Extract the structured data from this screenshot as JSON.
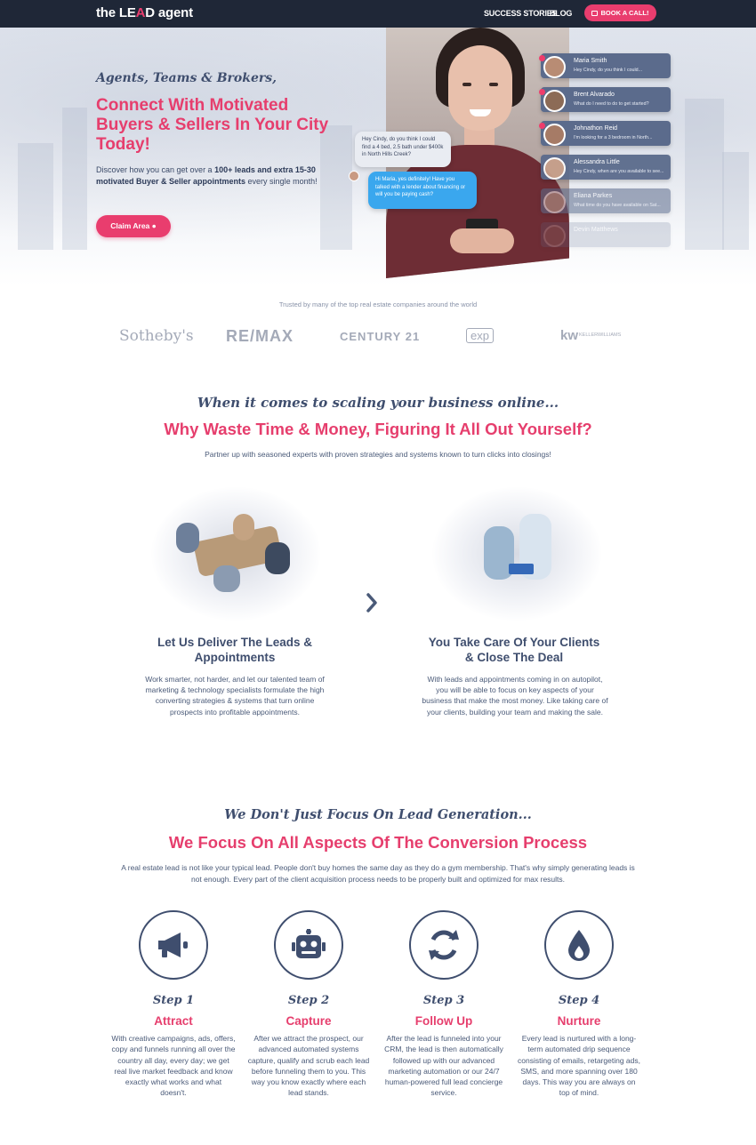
{
  "nav": {
    "logo_pre": "the LE",
    "logo_a": "A",
    "logo_post": "D agent",
    "link_success": "SUCCESS STORIES",
    "link_blog": "BLOG",
    "book_label": "BOOK A CALL!"
  },
  "hero": {
    "tagline": "Agents, Teams & Brokers,",
    "headline": "Connect With Motivated Buyers & Sellers In Your City Today!",
    "desc_1": "Discover how you can get over a ",
    "desc_bold_1": "100+ leads and extra 15-30 motivated Buyer & Seller appointments",
    "desc_2": " every single month!",
    "claim_label": "Claim Area",
    "bubble_gray": "Hey Cindy, do you think I could find a 4 bed, 2.5 bath under $400k in North Hills Creek?",
    "bubble_blue": "Hi Maria, yes definitely! Have you talked with a lender about financing or will you be paying cash?",
    "contacts": [
      {
        "name": "Maria Smith",
        "msg": "Hey Cindy, do you think I could..."
      },
      {
        "name": "Brent Alvarado",
        "msg": "What do I need to do to get started?"
      },
      {
        "name": "Johnathon Reid",
        "msg": "I'm looking for a 3 bedroom in North..."
      },
      {
        "name": "Alessandra Little",
        "msg": "Hey Cindy, when are you available to see..."
      },
      {
        "name": "Eliana Parkes",
        "msg": "What time do you have available on Sat..."
      },
      {
        "name": "Devin Matthews",
        "msg": ""
      }
    ]
  },
  "trusted": {
    "text": "Trusted by many of the top real estate companies around the world",
    "brands": [
      "Sotheby's",
      "RE/MAX",
      "CENTURY 21",
      "exp",
      "kw",
      "KELLERWILLIAMS"
    ]
  },
  "why": {
    "script": "When it comes to scaling your business online...",
    "title": "Why Waste Time & Money, Figuring It All Out Yourself?",
    "sub": "Partner up with seasoned experts with proven strategies and systems known to turn clicks into closings!",
    "col1_title": "Let Us Deliver The Leads & Appointments",
    "col1_text": "Work smarter, not harder, and let our talented team of marketing & technology specialists formulate the high converting strategies & systems that turn online prospects into profitable appointments.",
    "col2_title": "You Take Care Of Your Clients & Close The Deal",
    "col2_text": "With leads and appointments coming in on autopilot, you will be able to focus on key aspects of your business that make the most money. Like taking care of your clients, building your team and making the sale."
  },
  "process": {
    "script": "We Don't Just Focus On Lead Generation...",
    "title": "We Focus On All Aspects Of The Conversion Process",
    "sub": "A real estate lead is not like your typical lead. People don't buy homes the same day as they do a gym membership. That's why simply generating leads is not enough. Every part of the client acquisition process needs to be properly built and optimized for max results.",
    "steps": [
      {
        "label": "Step 1",
        "name": "Attract",
        "icon": "megaphone-icon",
        "text": "With creative campaigns, ads, offers, copy and funnels running all over the country all day, every day; we get real live market feedback and know exactly what works and what doesn't."
      },
      {
        "label": "Step 2",
        "name": "Capture",
        "icon": "robot-icon",
        "text": "After we attract the prospect, our advanced automated systems capture, qualify and scrub each lead before funneling them to you. This way you know exactly where each lead stands."
      },
      {
        "label": "Step 3",
        "name": "Follow Up",
        "icon": "sync-icon",
        "text": "After the lead is funneled into your CRM, the lead is then automatically followed up with our advanced marketing automation or our 24/7 human-powered full lead concierge service."
      },
      {
        "label": "Step 4",
        "name": "Nurture",
        "icon": "drop-icon",
        "text": "Every lead is nurtured with a long-term automated drip sequence consisting of emails, retargeting ads, SMS, and more spanning over 180 days. This way you are always on top of mind."
      }
    ]
  },
  "colors": {
    "brand": "#e93d6e",
    "navy": "#3f4e6e",
    "nav_bg": "#1f2737"
  }
}
